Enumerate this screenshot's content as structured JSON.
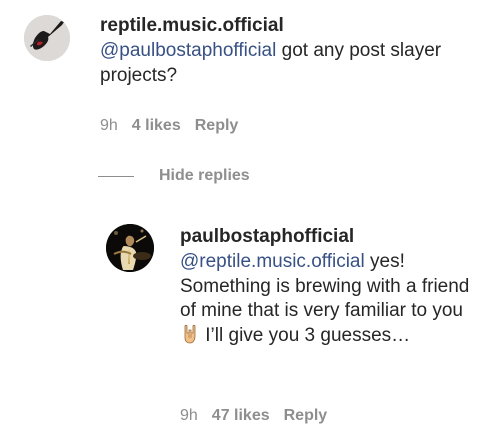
{
  "comment": {
    "username": "reptile.music.official",
    "mention": "@paulbostaphofficial",
    "text": " got any post slayer projects?",
    "time": "9h",
    "likes": "4 likes",
    "reply_label": "Reply",
    "avatar_icon": "guitar-avatar-icon"
  },
  "hide_replies": {
    "label": "Hide replies"
  },
  "reply": {
    "username": "paulbostaphofficial",
    "mention": "@reptile.music.official",
    "text_before_emoji": " yes! Something is brewing with a friend of mine that is very familiar to you ",
    "emoji_icon": "rock-on-hand-emoji-icon",
    "text_after_emoji": " I’ll give you 3 guesses…",
    "time": "9h",
    "likes": "47 likes",
    "reply_label": "Reply",
    "avatar_icon": "drummer-avatar-icon"
  }
}
